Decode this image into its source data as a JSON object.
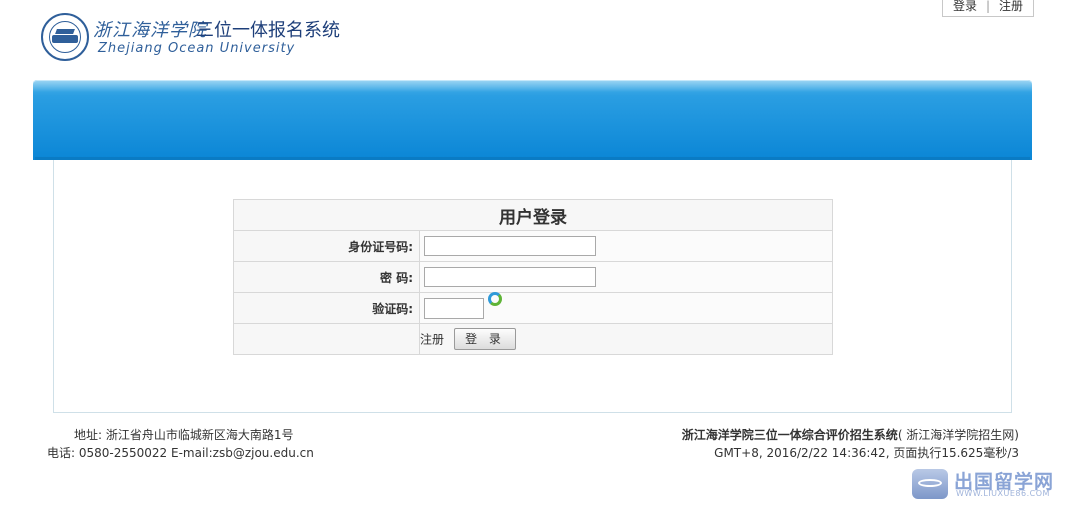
{
  "top_links": {
    "login": "登录",
    "register": "注册",
    "separator": "|"
  },
  "header": {
    "school_cn": "浙江海洋学院",
    "system_title": "三位一体报名系统",
    "school_en": "Zhejiang Ocean University"
  },
  "login_form": {
    "title": "用户登录",
    "id_label": "身份证号码:",
    "id_value": "",
    "password_label": "密 码:",
    "password_value": "",
    "captcha_label": "验证码:",
    "captcha_value": "",
    "register_link": "注册",
    "login_button": "登 录"
  },
  "footer": {
    "address": "地址: 浙江省舟山市临城新区海大南路1号",
    "phone": "电话: 0580-2550022 E-mail:zsb@zjou.edu.cn",
    "system_name": "浙江海洋学院三位一体综合评价招生系统",
    "site_name": "( 浙江海洋学院招生网)",
    "runtime": "GMT+8, 2016/2/22 14:36:42, 页面执行15.625毫秒/3"
  },
  "watermark": {
    "name": "出国留学网",
    "url": "WWW.LIUXUE86.COM"
  },
  "colors": {
    "banner_top": "#4fb4ea",
    "banner_bottom": "#0b86d6",
    "brand_blue": "#2f5f9a"
  }
}
